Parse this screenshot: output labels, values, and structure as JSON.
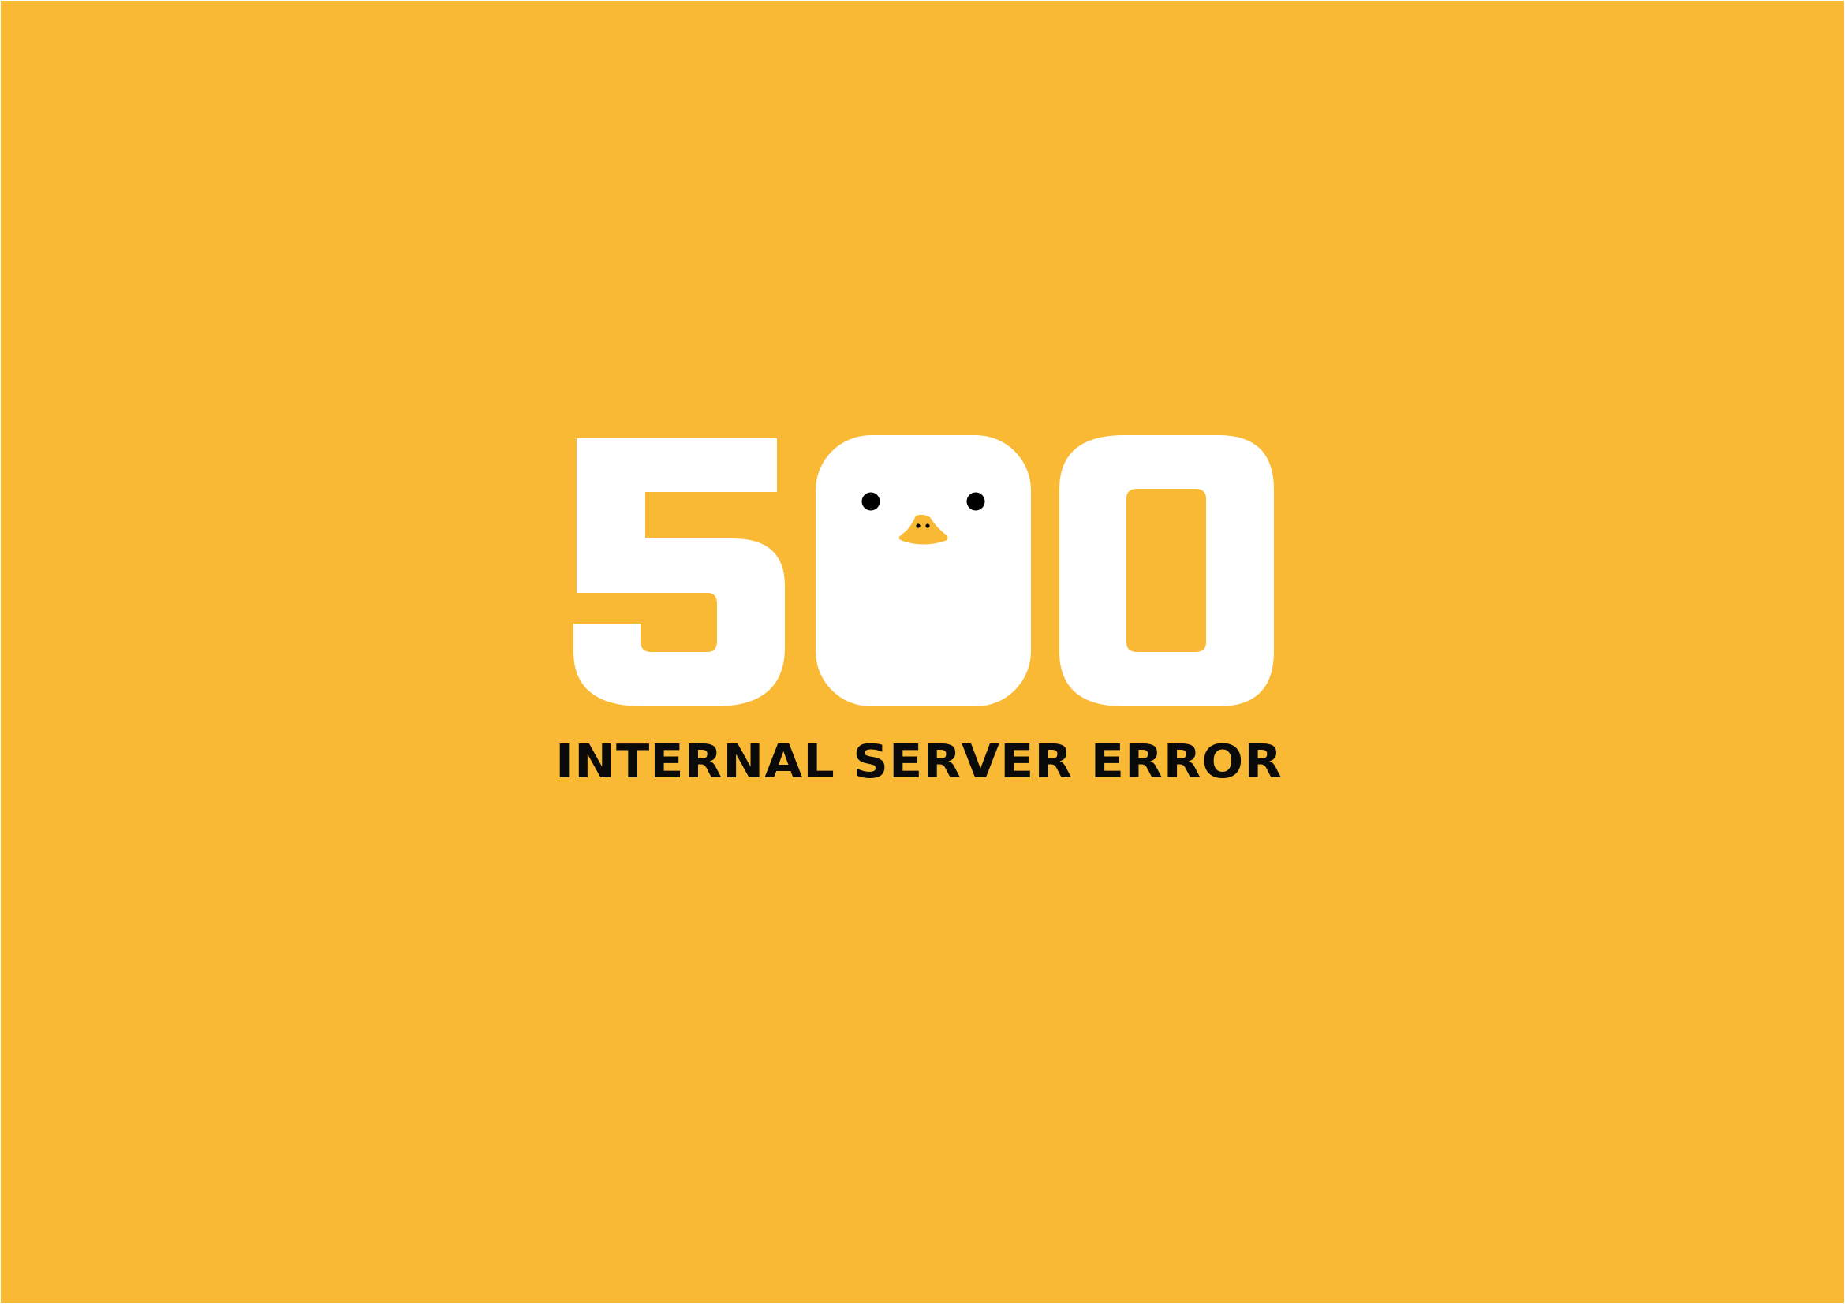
{
  "error_page": {
    "code": "500",
    "message": "INTERNAL SERVER ERROR"
  },
  "colors": {
    "background": "#FAB934",
    "numerals": "#FFFFFF",
    "text": "#0A0A0A",
    "eyes": "#000000",
    "beak": "#FAB934"
  },
  "icons": {
    "mascot": "duck-face-icon"
  }
}
